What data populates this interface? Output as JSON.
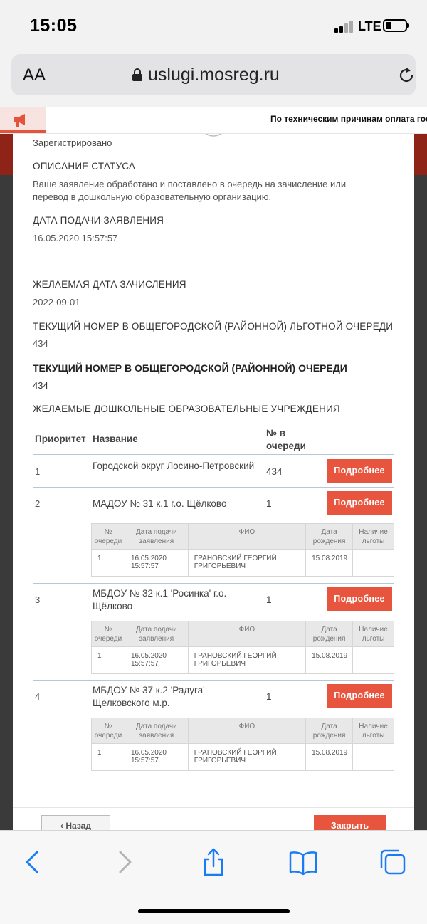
{
  "status_bar": {
    "time": "15:05",
    "network": "LTE"
  },
  "browser": {
    "text_size_label": "AA",
    "url": "uslugi.mosreg.ru"
  },
  "notice": {
    "text": "По техническим причинам оплата гос"
  },
  "application": {
    "status_value": "Зарегистрировано",
    "status_description_label": "ОПИСАНИЕ СТАТУСА",
    "status_description_line1": "Ваше заявление обработано и поставлено в очередь на зачисление или",
    "status_description_line2": "перевод в дошкольную образовательную организацию.",
    "submit_date_label": "ДАТА ПОДАЧИ ЗАЯВЛЕНИЯ",
    "submit_date_value": "16.05.2020 15:57:57",
    "desired_date_label": "ЖЕЛАЕМАЯ ДАТА ЗАЧИСЛЕНИЯ",
    "desired_date_value": "2022-09-01",
    "benefit_queue_label": "ТЕКУЩИЙ НОМЕР В ОБЩЕГОРОДСКОЙ (РАЙОННОЙ) ЛЬГОТНОЙ ОЧЕРЕДИ",
    "benefit_queue_value": "434",
    "queue_label": "ТЕКУЩИЙ НОМЕР В ОБЩЕГОРОДСКОЙ (РАЙОННОЙ) ОЧЕРЕДИ",
    "queue_value": "434",
    "institutions_label": "ЖЕЛАЕМЫЕ ДОШКОЛЬНЫЕ ОБРАЗОВАТЕЛЬНЫЕ УЧРЕЖДЕНИЯ"
  },
  "institutions_table": {
    "headers": {
      "priority": "Приоритет",
      "name": "Название",
      "queue_line1": "№ в",
      "queue_line2": "очереди"
    },
    "more_label": "Подробнее",
    "rows": [
      {
        "priority": "1",
        "name": "Городской округ Лосино-Петровский",
        "queue": "434"
      },
      {
        "priority": "2",
        "name": "МАДОУ № 31 к.1 г.о. Щёлково",
        "queue": "1"
      },
      {
        "priority": "3",
        "name_line1": "МБДОУ № 32 к.1 'Росинка' г.о.",
        "name_line2": "Щёлково",
        "queue": "1"
      },
      {
        "priority": "4",
        "name_line1": "МБДОУ № 37 к.2 'Радуга'",
        "name_line2": "Щелковского м.р.",
        "queue": "1"
      }
    ]
  },
  "sub_table": {
    "headers": {
      "num_line1": "№",
      "num_line2": "очереди",
      "date_line1": "Дата подачи",
      "date_line2": "заявления",
      "fio": "ФИО",
      "birth_line1": "Дата",
      "birth_line2": "рождения",
      "benefit_line1": "Наличие",
      "benefit_line2": "льготы"
    },
    "row": {
      "num": "1",
      "date_line1": "16.05.2020",
      "date_line2": "15:57:57",
      "fio_line1": "ГРАНОВСКИЙ ГЕОРГИЙ",
      "fio_line2": "ГРИГОРЬЕВИЧ",
      "birth": "15.08.2019",
      "benefit": ""
    }
  },
  "footer": {
    "back_label": "Назад",
    "close_label": "Закрыть"
  }
}
